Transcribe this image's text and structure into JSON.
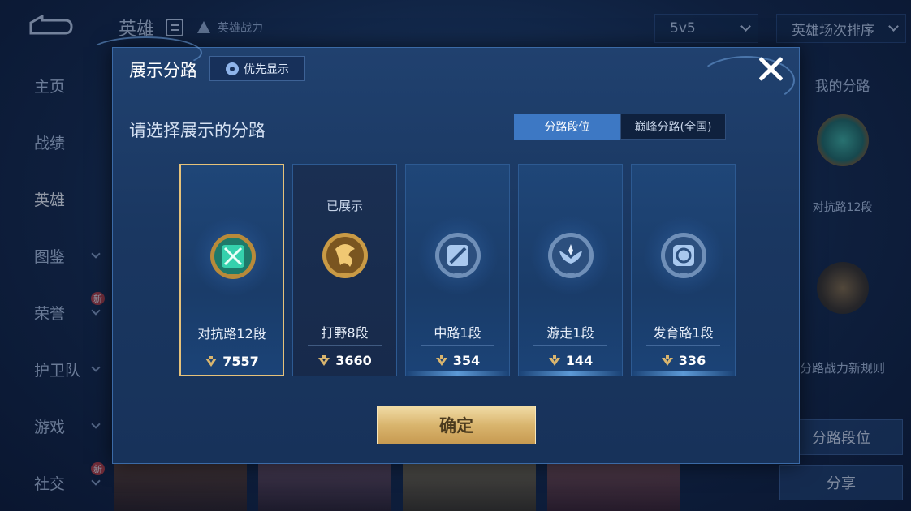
{
  "background": {
    "title": "英雄",
    "subtitle": "英雄战力",
    "mode_dropdown": "5v5",
    "sort_dropdown": "英雄场次排序",
    "side_menu": [
      {
        "label": "主页",
        "has_chevron": false,
        "new": false
      },
      {
        "label": "战绩",
        "has_chevron": false,
        "new": false
      },
      {
        "label": "英雄",
        "has_chevron": false,
        "new": false,
        "active": true
      },
      {
        "label": "图鉴",
        "has_chevron": true,
        "new": false
      },
      {
        "label": "荣誉",
        "has_chevron": true,
        "new": true
      },
      {
        "label": "护卫队",
        "has_chevron": true,
        "new": false
      },
      {
        "label": "游戏",
        "has_chevron": true,
        "new": false
      },
      {
        "label": "社交",
        "has_chevron": true,
        "new": true
      }
    ],
    "new_badge": "新",
    "right_panel": {
      "title": "我的分路",
      "emblem_label": "对抗路12段",
      "rule_link": "分路战力新规则",
      "lane_button": "分路段位",
      "share_button": "分享"
    }
  },
  "modal": {
    "title": "展示分路",
    "priority_button": "优先显示",
    "prompt": "请选择展示的分路",
    "tabs": [
      {
        "label": "分路段位",
        "active": true
      },
      {
        "label": "巅峰分路(全国)",
        "active": false
      }
    ],
    "shown_label": "已展示",
    "lanes": [
      {
        "name": "对抗路12段",
        "score": "7557",
        "selected": true,
        "shown": false,
        "emblem": "clash-lane-icon",
        "color": "#2fc7a3"
      },
      {
        "name": "打野8段",
        "score": "3660",
        "selected": false,
        "shown": true,
        "emblem": "jungle-icon",
        "color": "#d8a24a"
      },
      {
        "name": "中路1段",
        "score": "354",
        "selected": false,
        "shown": false,
        "emblem": "mid-lane-icon",
        "color": "#8fb6e4"
      },
      {
        "name": "游走1段",
        "score": "144",
        "selected": false,
        "shown": false,
        "emblem": "roam-icon",
        "color": "#8fb6e4"
      },
      {
        "name": "发育路1段",
        "score": "336",
        "selected": false,
        "shown": false,
        "emblem": "farm-lane-icon",
        "color": "#8fb6e4"
      }
    ],
    "confirm_button": "确定"
  },
  "colors": {
    "accent_gold": "#e6c27a",
    "tab_active": "#3d78c4",
    "modal_bg": "#1a3761"
  }
}
